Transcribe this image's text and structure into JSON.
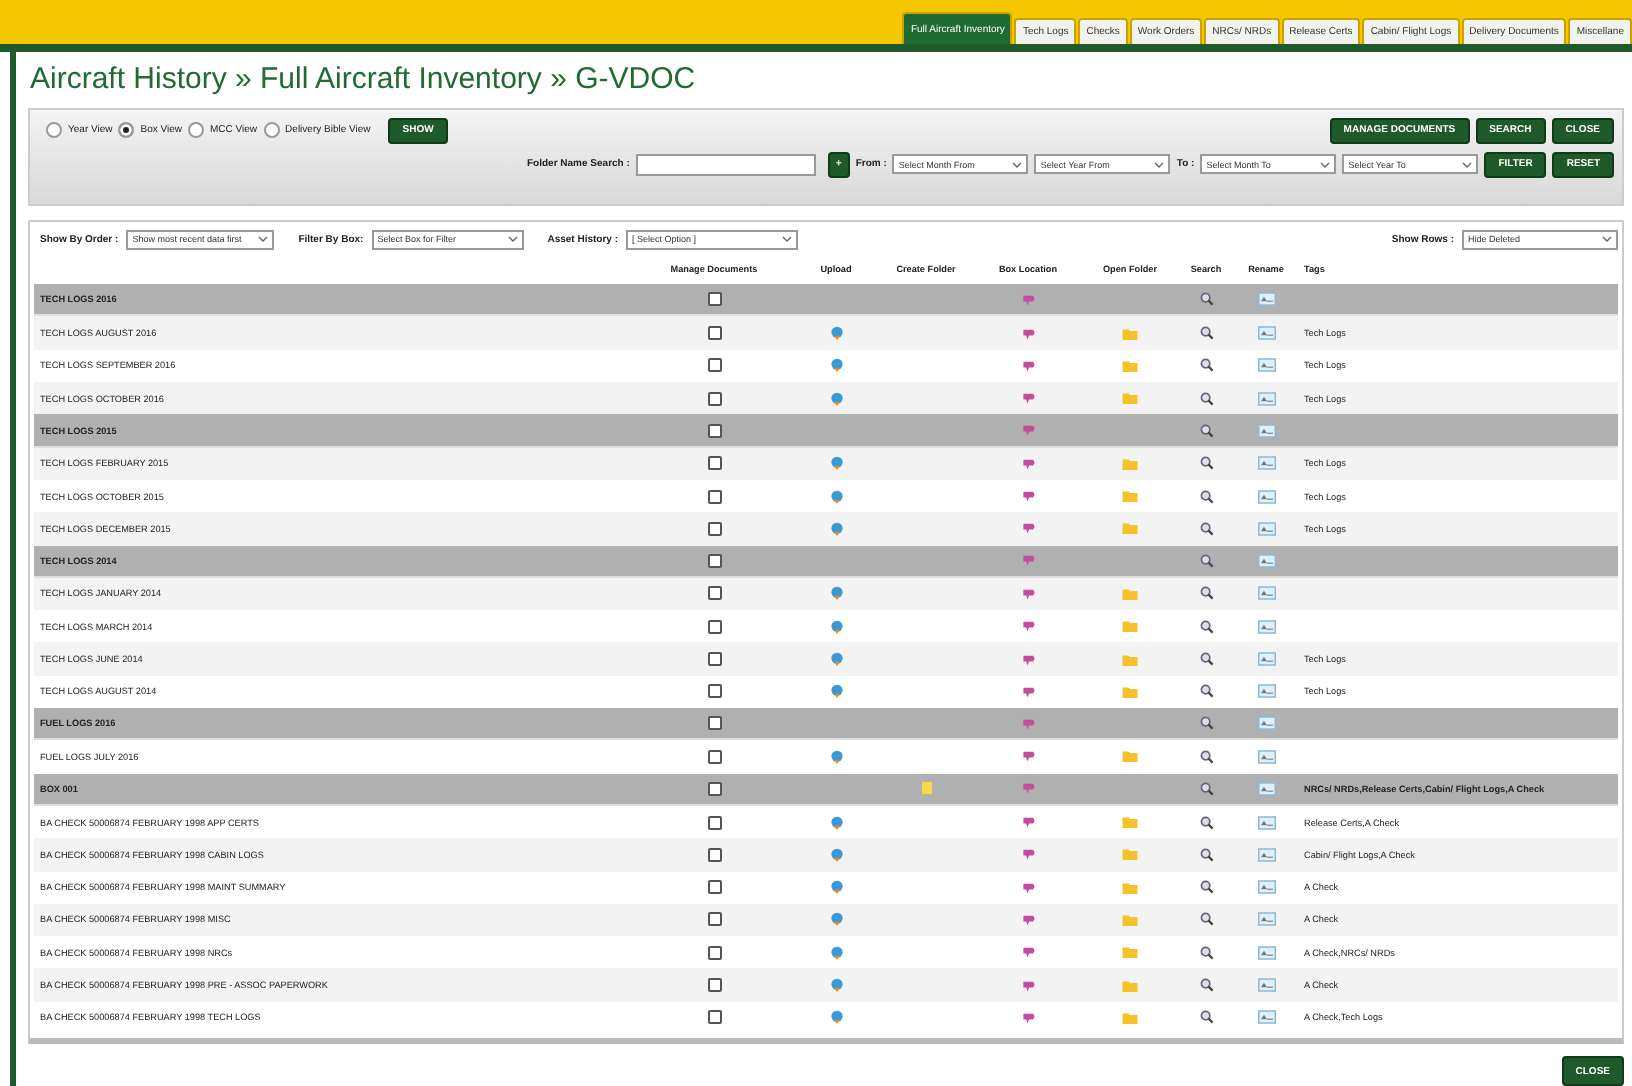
{
  "tabs": [
    {
      "label": "Full Aircraft Inventory",
      "selected": true
    },
    {
      "label": "Tech Logs",
      "selected": false
    },
    {
      "label": "Checks",
      "selected": false
    },
    {
      "label": "Work Orders",
      "selected": false
    },
    {
      "label": "NRCs/ NRDs",
      "selected": false
    },
    {
      "label": "Release Certs",
      "selected": false
    },
    {
      "label": "Cabin/ Flight Logs",
      "selected": false
    },
    {
      "label": "Delivery Documents",
      "selected": false
    },
    {
      "label": "Miscellane",
      "selected": false
    }
  ],
  "title": "Aircraft History » Full Aircraft Inventory » G-VDOC",
  "views": [
    {
      "label": "Year View",
      "selected": false
    },
    {
      "label": "Box View",
      "selected": true
    },
    {
      "label": "MCC View",
      "selected": false
    },
    {
      "label": "Delivery Bible View",
      "selected": false
    }
  ],
  "show_button": "SHOW",
  "top_buttons": [
    "MANAGE DOCUMENTS",
    "SEARCH",
    "CLOSE"
  ],
  "folder_search": {
    "label": "Folder Name Search :",
    "add_button": "+"
  },
  "from": {
    "label": "From :",
    "month": "Select Month From",
    "year": "Select Year From"
  },
  "to": {
    "label": "To :",
    "month": "Select Month To",
    "year": "Select Year To"
  },
  "filter_buttons": [
    "FILTER",
    "RESET"
  ],
  "options": [
    {
      "label": "Show By Order :",
      "value": "Show most recent data first"
    },
    {
      "label": "Filter By Box:",
      "value": "Select Box for Filter"
    },
    {
      "label": "Asset History :",
      "value": "[ Select Option ]"
    }
  ],
  "show_rows": {
    "label": "Show Rows :",
    "value": "Hide Deleted"
  },
  "columns": [
    "Manage Documents",
    "Upload",
    "Create Folder",
    "Box Location",
    "Open Folder",
    "Search",
    "Rename",
    "Tags"
  ],
  "rows": [
    {
      "kind": "group",
      "name": "TECH LOGS 2016",
      "checked": false
    },
    {
      "kind": "item",
      "name": "TECH LOGS AUGUST 2016",
      "checked": false,
      "tags": "Tech Logs"
    },
    {
      "kind": "item",
      "name": "TECH LOGS SEPTEMBER 2016",
      "checked": false,
      "tags": "Tech Logs"
    },
    {
      "kind": "item",
      "name": "TECH LOGS OCTOBER 2016",
      "checked": false,
      "tags": "Tech Logs"
    },
    {
      "kind": "group",
      "name": "TECH LOGS 2015",
      "checked": false
    },
    {
      "kind": "item",
      "name": "TECH LOGS FEBRUARY 2015",
      "checked": false,
      "tags": "Tech Logs"
    },
    {
      "kind": "item",
      "name": "TECH LOGS OCTOBER 2015",
      "checked": false,
      "tags": "Tech Logs"
    },
    {
      "kind": "item",
      "name": "TECH LOGS DECEMBER 2015",
      "checked": false,
      "tags": "Tech Logs"
    },
    {
      "kind": "group",
      "name": "TECH LOGS 2014",
      "checked": false
    },
    {
      "kind": "item",
      "name": "TECH LOGS JANUARY 2014",
      "checked": false
    },
    {
      "kind": "item",
      "name": "TECH LOGS MARCH 2014",
      "checked": false
    },
    {
      "kind": "item",
      "name": "TECH LOGS JUNE 2014",
      "checked": false,
      "tags": "Tech Logs"
    },
    {
      "kind": "item",
      "name": "TECH LOGS AUGUST 2014",
      "checked": false,
      "tags": "Tech Logs"
    },
    {
      "kind": "group",
      "name": "FUEL LOGS 2016",
      "checked": false
    },
    {
      "kind": "item",
      "name": "FUEL LOGS JULY 2016",
      "checked": false
    },
    {
      "kind": "group",
      "name": "BOX 001",
      "checked": false,
      "create_folder": true,
      "tags": "NRCs/ NRDs,Release Certs,Cabin/ Flight Logs,A Check"
    },
    {
      "kind": "item",
      "name": "BA CHECK 50006874 FEBRUARY 1998 APP CERTS",
      "checked": false,
      "tags": "Release Certs,A Check"
    },
    {
      "kind": "item",
      "name": "BA CHECK 50006874 FEBRUARY 1998 CABIN LOGS",
      "checked": false,
      "tags": "Cabin/ Flight Logs,A Check"
    },
    {
      "kind": "item",
      "name": "BA CHECK 50006874 FEBRUARY 1998 MAINT SUMMARY",
      "checked": false,
      "tags": "A Check"
    },
    {
      "kind": "item",
      "name": "BA CHECK 50006874 FEBRUARY 1998 MISC",
      "checked": false,
      "tags": "A Check"
    },
    {
      "kind": "item",
      "name": "BA CHECK 50006874 FEBRUARY 1998 NRCs",
      "checked": false,
      "tags": "A Check,NRCs/ NRDs"
    },
    {
      "kind": "item",
      "name": "BA CHECK 50006874 FEBRUARY 1998 PRE - ASSOC PAPERWORK",
      "checked": false,
      "tags": "A Check"
    },
    {
      "kind": "item",
      "name": "BA CHECK 50006874 FEBRUARY 1998 TECH LOGS",
      "checked": false,
      "tags": "A Check,Tech Logs"
    }
  ],
  "bottom_button": "CLOSE"
}
